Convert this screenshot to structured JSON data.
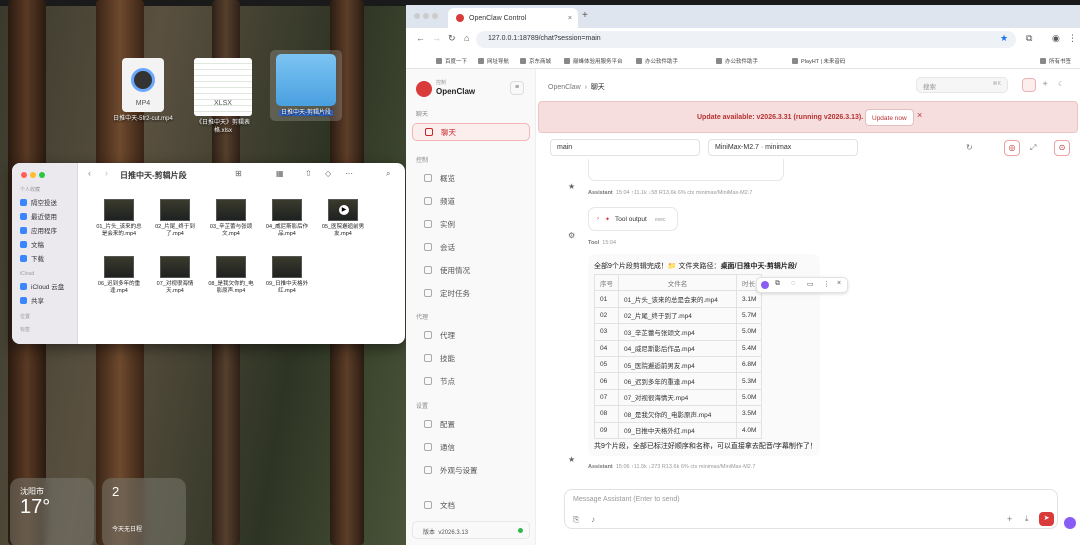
{
  "desktop": {
    "icons": [
      {
        "name": "日推中天-5fr2-cut.mp4",
        "ext": "MP4"
      },
      {
        "name": "《日推中天》剪辑表格.xlsx",
        "ext": "XLSX"
      },
      {
        "name": "日推中天-剪辑片段",
        "ext": ""
      }
    ],
    "weather": {
      "city": "沈阳市",
      "temp": "17°"
    },
    "calendar": {
      "date": "2",
      "note": "今天无日程"
    }
  },
  "finder": {
    "title": "日推中天-剪辑片段",
    "sidebar": {
      "favorites_label": "个人收藏",
      "items": [
        "隔空投送",
        "最近使用",
        "应用程序",
        "文稿",
        "下载"
      ],
      "icloud_label": "iCloud",
      "icloud_items": [
        "iCloud 云盘",
        "共享"
      ],
      "location_label": "位置",
      "tags_label": "标签"
    },
    "files": [
      "01_片头_该来的总是会来的.mp4",
      "02_片尾_终于到了.mp4",
      "03_辛芷蕾与张颂文.mp4",
      "04_威尼斯影后作品.mp4",
      "05_医院邂逅前男友.mp4",
      "06_迟到多年的重逢.mp4",
      "07_对视很海情天.mp4",
      "08_是我欠你的_电影原声.mp4",
      "09_日推中天格外红.mp4"
    ]
  },
  "browser": {
    "tab_title": "OpenClaw Control",
    "url": "127.0.0.1:18789/chat?session=main",
    "bookmarks": [
      "百度一下",
      "网址导航",
      "京东商城",
      "巅峰体验用服务平台",
      "办公软件助手",
      "办公软件助手",
      "PlayHT | 未来音码"
    ],
    "all_bookmarks": "所有书签"
  },
  "app": {
    "brand_top": "控制",
    "brand": "OpenClaw",
    "breadcrumb_root": "OpenClaw",
    "breadcrumb_current": "聊天",
    "search_placeholder": "搜索",
    "search_kbd": "⌘K",
    "groups": {
      "chat": "聊天",
      "control": "控制",
      "agent": "代理",
      "settings": "设置"
    },
    "nav_chat": "聊天",
    "nav_control": [
      "概览",
      "频道",
      "实例",
      "会话",
      "使用情况",
      "定时任务"
    ],
    "nav_agent": [
      "代理",
      "技能",
      "节点"
    ],
    "nav_settings": [
      "配置",
      "通信",
      "外观与设置"
    ],
    "docs": "文档",
    "version_label": "版本",
    "version": "v2026.3.13",
    "update_text": "Update available: v2026.3.31 (running v2026.3.13).",
    "update_button": "Update now",
    "session": "main",
    "model": "MiniMax-M2.7 · minimax",
    "messages": {
      "tool_label": "Tool",
      "assistant": "Assistant",
      "meta1": "15:04  ↑11.1k  ↓58  R13.6k  6% ctx  minimax/MiniMax-M2.7",
      "tool_output": "Tool output",
      "tool_output_sub": "exec",
      "tool_time": "15:04",
      "result_intro": "全部9个片段剪辑完成！📁 文件夹路径：",
      "result_path": "桌面/日推中天-剪辑片段/",
      "table_headers": [
        "序号",
        "文件名",
        "时长"
      ],
      "rows": [
        [
          "01",
          "01_片头_该来的总是会来的.mp4",
          "3.1M"
        ],
        [
          "02",
          "02_片尾_终于到了.mp4",
          "5.7M"
        ],
        [
          "03",
          "03_辛芷蕾与张颂文.mp4",
          "5.0M"
        ],
        [
          "04",
          "04_威尼斯影后作品.mp4",
          "5.4M"
        ],
        [
          "05",
          "05_医院邂逅前男友.mp4",
          "6.8M"
        ],
        [
          "06",
          "06_迟到多年的重逢.mp4",
          "5.3M"
        ],
        [
          "07",
          "07_对视很海情天.mp4",
          "5.0M"
        ],
        [
          "08",
          "08_是我欠你的_电影原声.mp4",
          "3.5M"
        ],
        [
          "09",
          "09_日推中天格外红.mp4",
          "4.0M"
        ]
      ],
      "summary": "共9个片段，全部已标注好顺序和名称，可以直接拿去配音/字幕制作了！",
      "meta2": "15:06  ↑11.5k  ↓273  R13.6k  6% ctx  minimax/MiniMax-M2.7"
    },
    "composer_placeholder": "Message Assistant (Enter to send)"
  },
  "colors": {
    "accent": "#d93a3a",
    "banner_bg": "#f6dede"
  }
}
